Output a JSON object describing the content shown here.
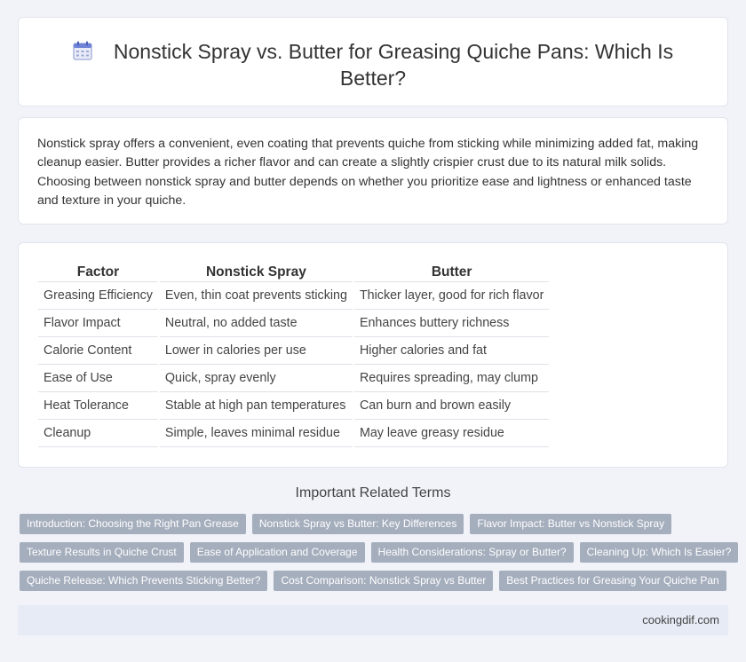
{
  "header": {
    "title": "Nonstick Spray vs. Butter for Greasing Quiche Pans: Which Is Better?",
    "icon": "calendar-icon"
  },
  "intro": {
    "text": "Nonstick spray offers a convenient, even coating that prevents quiche from sticking while minimizing added fat, making cleanup easier. Butter provides a richer flavor and can create a slightly crispier crust due to its natural milk solids. Choosing between nonstick spray and butter depends on whether you prioritize ease and lightness or enhanced taste and texture in your quiche."
  },
  "table": {
    "headers": [
      "Factor",
      "Nonstick Spray",
      "Butter"
    ],
    "rows": [
      [
        "Greasing Efficiency",
        "Even, thin coat prevents sticking",
        "Thicker layer, good for rich flavor"
      ],
      [
        "Flavor Impact",
        "Neutral, no added taste",
        "Enhances buttery richness"
      ],
      [
        "Calorie Content",
        "Lower in calories per use",
        "Higher calories and fat"
      ],
      [
        "Ease of Use",
        "Quick, spray evenly",
        "Requires spreading, may clump"
      ],
      [
        "Heat Tolerance",
        "Stable at high pan temperatures",
        "Can burn and brown easily"
      ],
      [
        "Cleanup",
        "Simple, leaves minimal residue",
        "May leave greasy residue"
      ]
    ]
  },
  "related": {
    "title": "Important Related Terms",
    "rows": [
      [
        "Introduction: Choosing the Right Pan Grease",
        "Nonstick Spray vs Butter: Key Differences",
        "Flavor Impact: Butter vs Nonstick Spray"
      ],
      [
        "Texture Results in Quiche Crust",
        "Ease of Application and Coverage",
        "Health Considerations: Spray or Butter?",
        "Cleaning Up: Which Is Easier?"
      ],
      [
        "Quiche Release: Which Prevents Sticking Better?",
        "Cost Comparison: Nonstick Spray vs Butter",
        "Best Practices for Greasing Your Quiche Pan"
      ]
    ]
  },
  "footer": {
    "site": "cookingdif.com"
  },
  "colors": {
    "background": "#f1f3f8",
    "tag_bg": "#a5aebd",
    "footer_bg": "#e6ebf5"
  }
}
